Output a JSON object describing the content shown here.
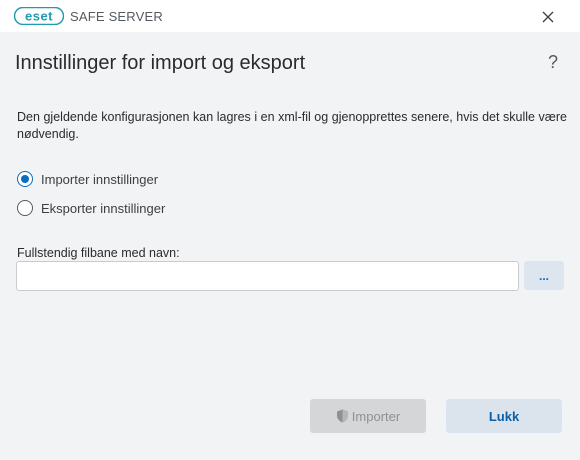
{
  "window": {
    "brand": "eset",
    "product_name": "SAFE SERVER",
    "close_icon": "close-icon",
    "brand_color": "#1f9cb0"
  },
  "dialog": {
    "title": "Innstillinger for import og eksport",
    "help": "?",
    "description": "Den gjeldende konfigurasjonen kan lagres i en xml-fil og gjenopprettes senere, hvis det skulle være nødvendig."
  },
  "options": [
    {
      "label": "Importer innstillinger",
      "selected": true
    },
    {
      "label": "Eksporter innstillinger",
      "selected": false
    }
  ],
  "path_field": {
    "label": "Fullstendig filbane med navn:",
    "value": "",
    "browse_label": "..."
  },
  "buttons": {
    "import_label": "Importer",
    "import_enabled": false,
    "close_label": "Lukk"
  },
  "colors": {
    "accent": "#0c6ebf",
    "background": "#f2f3f5"
  }
}
